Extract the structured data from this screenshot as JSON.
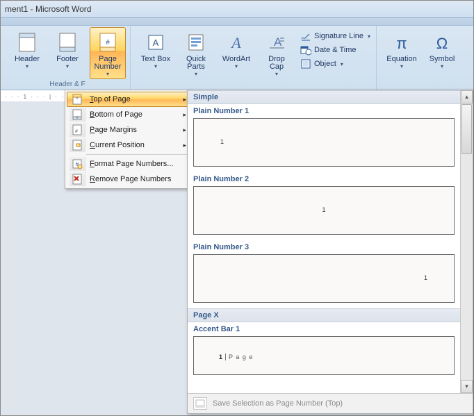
{
  "title": "ment1 - Microsoft Word",
  "ribbon": {
    "header_footer": {
      "header": "Header",
      "footer": "Footer",
      "page_number": "Page Number",
      "group_label": "Header & F"
    },
    "text_group": {
      "text_box": "Text Box",
      "quick_parts": "Quick Parts",
      "wordart": "WordArt",
      "drop_cap": "Drop Cap",
      "signature_line": "Signature Line",
      "date_time": "Date & Time",
      "object": "Object"
    },
    "symbols": {
      "equation": "Equation",
      "symbol": "Symbol"
    }
  },
  "ruler_text": "· · · 1 · · · | · · · | · · · 1 · · · | ·",
  "menu": {
    "top_of_page": "Top of Page",
    "bottom_of_page": "Bottom of Page",
    "page_margins": "Page Margins",
    "current_position": "Current Position",
    "format": "Format Page Numbers...",
    "remove": "Remove Page Numbers"
  },
  "gallery": {
    "section_simple": "Simple",
    "plain1": "Plain Number 1",
    "plain2": "Plain Number 2",
    "plain3": "Plain Number 3",
    "section_pagex": "Page X",
    "accent1": "Accent Bar 1",
    "accent1_num": "1",
    "accent1_word": "P a g e",
    "save_selection": "Save Selection as Page Number (Top)",
    "sample_number": "1"
  }
}
